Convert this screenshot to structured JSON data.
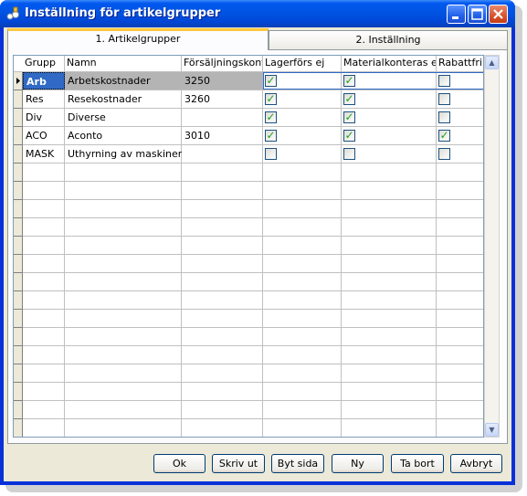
{
  "window": {
    "title": "Inställning för artikelgrupper",
    "icon": "app-icon"
  },
  "tabs": [
    {
      "label": "1. Artikelgrupper",
      "active": true
    },
    {
      "label": "2. Inställning",
      "active": false
    }
  ],
  "grid": {
    "columns": [
      "Grupp",
      "Namn",
      "Försäljningskonto",
      "Lagerförs ej",
      "Materialkonteras ej",
      "Rabattfri"
    ],
    "rows": [
      {
        "grupp": "Arb",
        "namn": "Arbetskostnader",
        "konto": "3250",
        "lagerfors_ej": true,
        "materialkonteras_ej": true,
        "rabattfri": false,
        "selected": true
      },
      {
        "grupp": "Res",
        "namn": "Resekostnader",
        "konto": "3260",
        "lagerfors_ej": true,
        "materialkonteras_ej": true,
        "rabattfri": false
      },
      {
        "grupp": "Div",
        "namn": "Diverse",
        "konto": "",
        "lagerfors_ej": true,
        "materialkonteras_ej": true,
        "rabattfri": false
      },
      {
        "grupp": "ACO",
        "namn": "Aconto",
        "konto": "3010",
        "lagerfors_ej": true,
        "materialkonteras_ej": true,
        "rabattfri": true
      },
      {
        "grupp": "MASK",
        "namn": "Uthyrning av maskiner",
        "konto": "",
        "lagerfors_ej": false,
        "materialkonteras_ej": false,
        "rabattfri": false
      }
    ],
    "empty_rows": 15
  },
  "buttons": {
    "ok": "Ok",
    "print": "Skriv ut",
    "page": "Byt sida",
    "new": "Ny",
    "delete": "Ta bort",
    "cancel": "Avbryt"
  },
  "colors": {
    "titlebar": "#0054e3",
    "selection": "#316ac5",
    "check": "#21a121"
  }
}
